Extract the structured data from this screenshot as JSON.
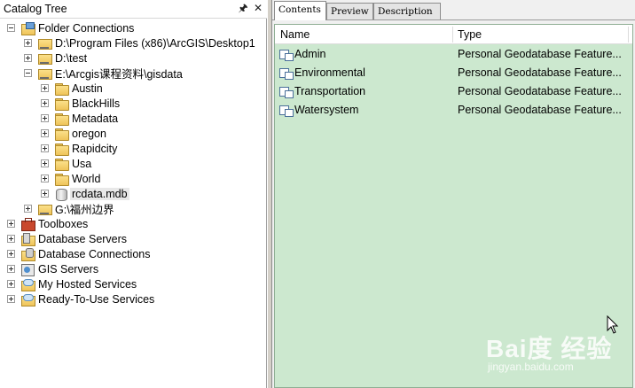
{
  "catalog_tree": {
    "title": "Catalog Tree",
    "pin_icon": "pin-icon",
    "close_icon": "close-icon",
    "nodes": [
      {
        "label": "Folder Connections",
        "icon": "folder-connections-icon",
        "expander": "collapse"
      },
      {
        "label": "D:\\Program Files (x86)\\ArcGIS\\Desktop1",
        "icon": "folder-icon",
        "expander": "expand"
      },
      {
        "label": "D:\\test",
        "icon": "folder-icon",
        "expander": "expand"
      },
      {
        "label": "E:\\Arcgis课程资料\\gisdata",
        "icon": "folder-icon",
        "expander": "collapse"
      },
      {
        "label": "Austin",
        "icon": "folder-icon",
        "expander": "expand"
      },
      {
        "label": "BlackHills",
        "icon": "folder-icon",
        "expander": "expand"
      },
      {
        "label": "Metadata",
        "icon": "folder-icon",
        "expander": "expand"
      },
      {
        "label": "oregon",
        "icon": "folder-icon",
        "expander": "expand"
      },
      {
        "label": "Rapidcity",
        "icon": "folder-icon",
        "expander": "expand"
      },
      {
        "label": "Usa",
        "icon": "folder-icon",
        "expander": "expand"
      },
      {
        "label": "World",
        "icon": "folder-icon",
        "expander": "expand"
      },
      {
        "label": "rcdata.mdb",
        "icon": "personal-geodatabase-icon",
        "expander": "expand",
        "selected": true
      },
      {
        "label": "G:\\福州边界",
        "icon": "folder-icon",
        "expander": "expand"
      },
      {
        "label": "Toolboxes",
        "icon": "toolbox-icon",
        "expander": "expand"
      },
      {
        "label": "Database Servers",
        "icon": "database-servers-icon",
        "expander": "expand"
      },
      {
        "label": "Database Connections",
        "icon": "database-connections-icon",
        "expander": "expand"
      },
      {
        "label": "GIS Servers",
        "icon": "gis-servers-icon",
        "expander": "expand"
      },
      {
        "label": "My Hosted Services",
        "icon": "hosted-services-icon",
        "expander": "expand"
      },
      {
        "label": "Ready-To-Use Services",
        "icon": "ready-to-use-services-icon",
        "expander": "expand"
      }
    ]
  },
  "tabs": [
    {
      "label": "Contents",
      "active": true
    },
    {
      "label": "Preview",
      "active": false
    },
    {
      "label": "Description",
      "active": false
    }
  ],
  "contents": {
    "columns": {
      "name": "Name",
      "type": "Type"
    },
    "background_color": "#cce8cf",
    "rows": [
      {
        "name": "Admin",
        "type": "Personal Geodatabase Feature...",
        "icon": "feature-dataset-icon"
      },
      {
        "name": "Environmental",
        "type": "Personal Geodatabase Feature...",
        "icon": "feature-dataset-icon"
      },
      {
        "name": "Transportation",
        "type": "Personal Geodatabase Feature...",
        "icon": "feature-dataset-icon"
      },
      {
        "name": "Watersystem",
        "type": "Personal Geodatabase Feature...",
        "icon": "feature-dataset-icon"
      }
    ]
  },
  "watermark": {
    "logo": "Bai度 经验",
    "url": "jingyan.baidu.com"
  }
}
